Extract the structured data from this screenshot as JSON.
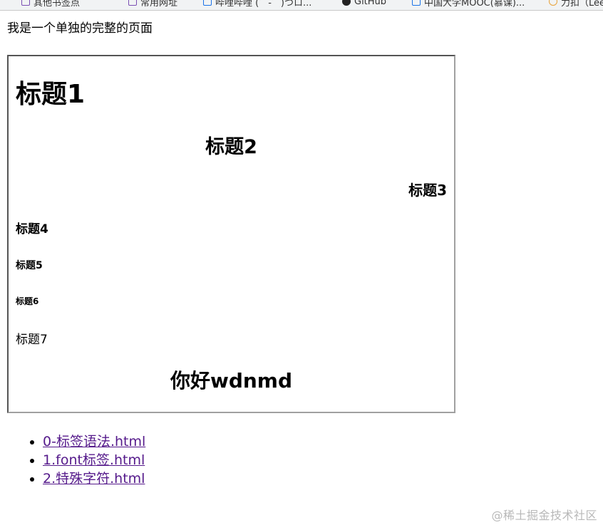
{
  "bookmarks": [
    {
      "label": "其他书签点",
      "icon": "folder-icon"
    },
    {
      "label": "常用网址",
      "icon": "folder-icon"
    },
    {
      "label": "哔哩哔哩 (゜-゜)つロ...",
      "icon": "bilibili-icon"
    },
    {
      "label": "GitHub",
      "icon": "github-icon"
    },
    {
      "label": "中国大学MOOC(慕课)...",
      "icon": "mooc-icon"
    },
    {
      "label": "力扣（LeetCode）",
      "icon": "leetcode-icon"
    }
  ],
  "intro": "我是一个单独的完整的页面",
  "frame": {
    "h1": "标题1",
    "h2": "标题2",
    "h3": "标题3",
    "h4": "标题4",
    "h5": "标题5",
    "h6": "标题6",
    "p7": "标题7",
    "hello": "你好wdnmd"
  },
  "links": [
    {
      "label": "0-标签语法.html"
    },
    {
      "label": "1.font标签.html"
    },
    {
      "label": "2.特殊字符.html"
    }
  ],
  "watermark": "@稀土掘金技术社区",
  "colors": {
    "visited_link": "#551a8b",
    "frame_border_dark": "#555555",
    "frame_border_light": "#a0a0a0"
  }
}
